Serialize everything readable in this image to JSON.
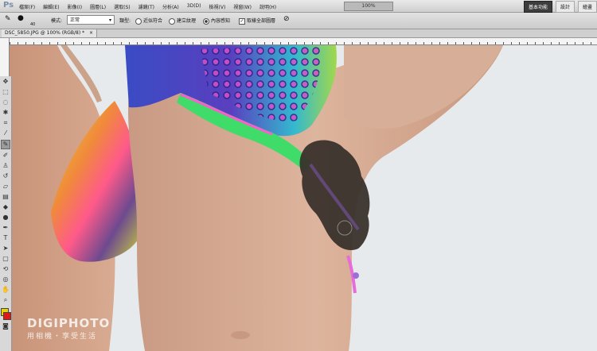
{
  "app": {
    "logo": "Ps"
  },
  "menu": [
    "檔案(F)",
    "編輯(E)",
    "影像(I)",
    "圖層(L)",
    "選取(S)",
    "濾鏡(T)",
    "分析(A)",
    "3D(D)",
    "檢視(V)",
    "視窗(W)",
    "說明(H)"
  ],
  "zoom_display": "100%",
  "workspaces": [
    "基本功能",
    "設計",
    "繪畫"
  ],
  "options": {
    "size_value": "40",
    "mode_label": "模式:",
    "mode_value": "正常",
    "type_label": "類型:",
    "type_opt1": "近似符合",
    "type_opt2": "建立紋理",
    "type_opt3": "內容感知",
    "sample_all": "取樣全部圖層"
  },
  "document_tab": {
    "title": "DSC_5850.JPG @ 100% (RGB/8) *"
  },
  "watermark": {
    "brand": "DIGIPHOTO",
    "subtitle": "用相機・享受生活"
  },
  "colors": {
    "foreground": "#e8d200",
    "background": "#e01818",
    "brush_area": "#3a322c"
  }
}
